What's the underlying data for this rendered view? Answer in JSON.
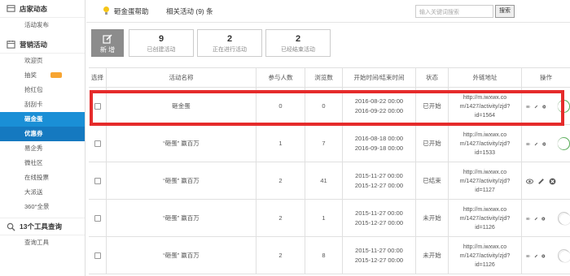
{
  "sidebar": {
    "section1": "店家动态",
    "section1_items": [
      "活动发布"
    ],
    "section2": "营销活动",
    "section2_items": [
      "欢迎页",
      "抽奖",
      "抢红包",
      "刮刮卡",
      "砸金蛋",
      "优惠券",
      "易企秀",
      "微社区",
      "在线投票",
      "大派送",
      "360°全景"
    ],
    "section3": "13个工具查询",
    "section3_items": [
      "查询工具"
    ]
  },
  "topbar": {
    "help": "砸金蛋帮助",
    "related": "相关活动 (9) 条",
    "search_placeholder": "输入关键词搜索",
    "search_btn": "搜索"
  },
  "stats": {
    "new_label": "新 增",
    "items": [
      {
        "num": "9",
        "label": "已创建活动"
      },
      {
        "num": "2",
        "label": "正在进行活动"
      },
      {
        "num": "2",
        "label": "已经结束活动"
      }
    ]
  },
  "table": {
    "headers": [
      "选择",
      "活动名称",
      "参与人数",
      "浏览数",
      "开始时间/结束时间",
      "状态",
      "外链地址",
      "操作"
    ],
    "rows": [
      {
        "name": "砸金蛋",
        "participants": "0",
        "views": "0",
        "start": "2016-08-22 00:00",
        "end": "2016-09-22 00:00",
        "status": "已开始",
        "url1": "http://m.iwxwx.co",
        "url2": "m/1427/activity/zjd?",
        "url3": "id=1564",
        "toggle": "on"
      },
      {
        "name": "“砸蛋” 赢百万",
        "participants": "1",
        "views": "7",
        "start": "2016-08-18 00:00",
        "end": "2016-09-18 00:00",
        "status": "已开始",
        "url1": "http://m.iwxwx.co",
        "url2": "m/1427/activity/zjd?",
        "url3": "id=1533",
        "toggle": "on"
      },
      {
        "name": "“砸蛋” 赢百万",
        "participants": "2",
        "views": "41",
        "start": "2015-11-27 00:00",
        "end": "2015-12-27 00:00",
        "status": "已结束",
        "url1": "http://m.iwxwx.co",
        "url2": "m/1427/activity/zjd?",
        "url3": "id=1127",
        "toggle": "none"
      },
      {
        "name": "“砸蛋” 赢百万",
        "participants": "2",
        "views": "1",
        "start": "2015-11-27 00:00",
        "end": "2015-12-27 00:00",
        "status": "未开始",
        "url1": "http://m.iwxwx.co",
        "url2": "m/1427/activity/zjd?",
        "url3": "id=1126",
        "toggle": "off"
      },
      {
        "name": "“砸蛋” 赢百万",
        "participants": "2",
        "views": "8",
        "start": "2015-11-27 00:00",
        "end": "2015-12-27 00:00",
        "status": "未开始",
        "url1": "http://m.iwxwx.co",
        "url2": "m/1427/activity/zjd?",
        "url3": "id=1126",
        "toggle": "off"
      }
    ]
  },
  "colors": {
    "accent": "#1a8fd6",
    "highlight": "#e52b2b",
    "toggle_on": "#5cb85c"
  }
}
